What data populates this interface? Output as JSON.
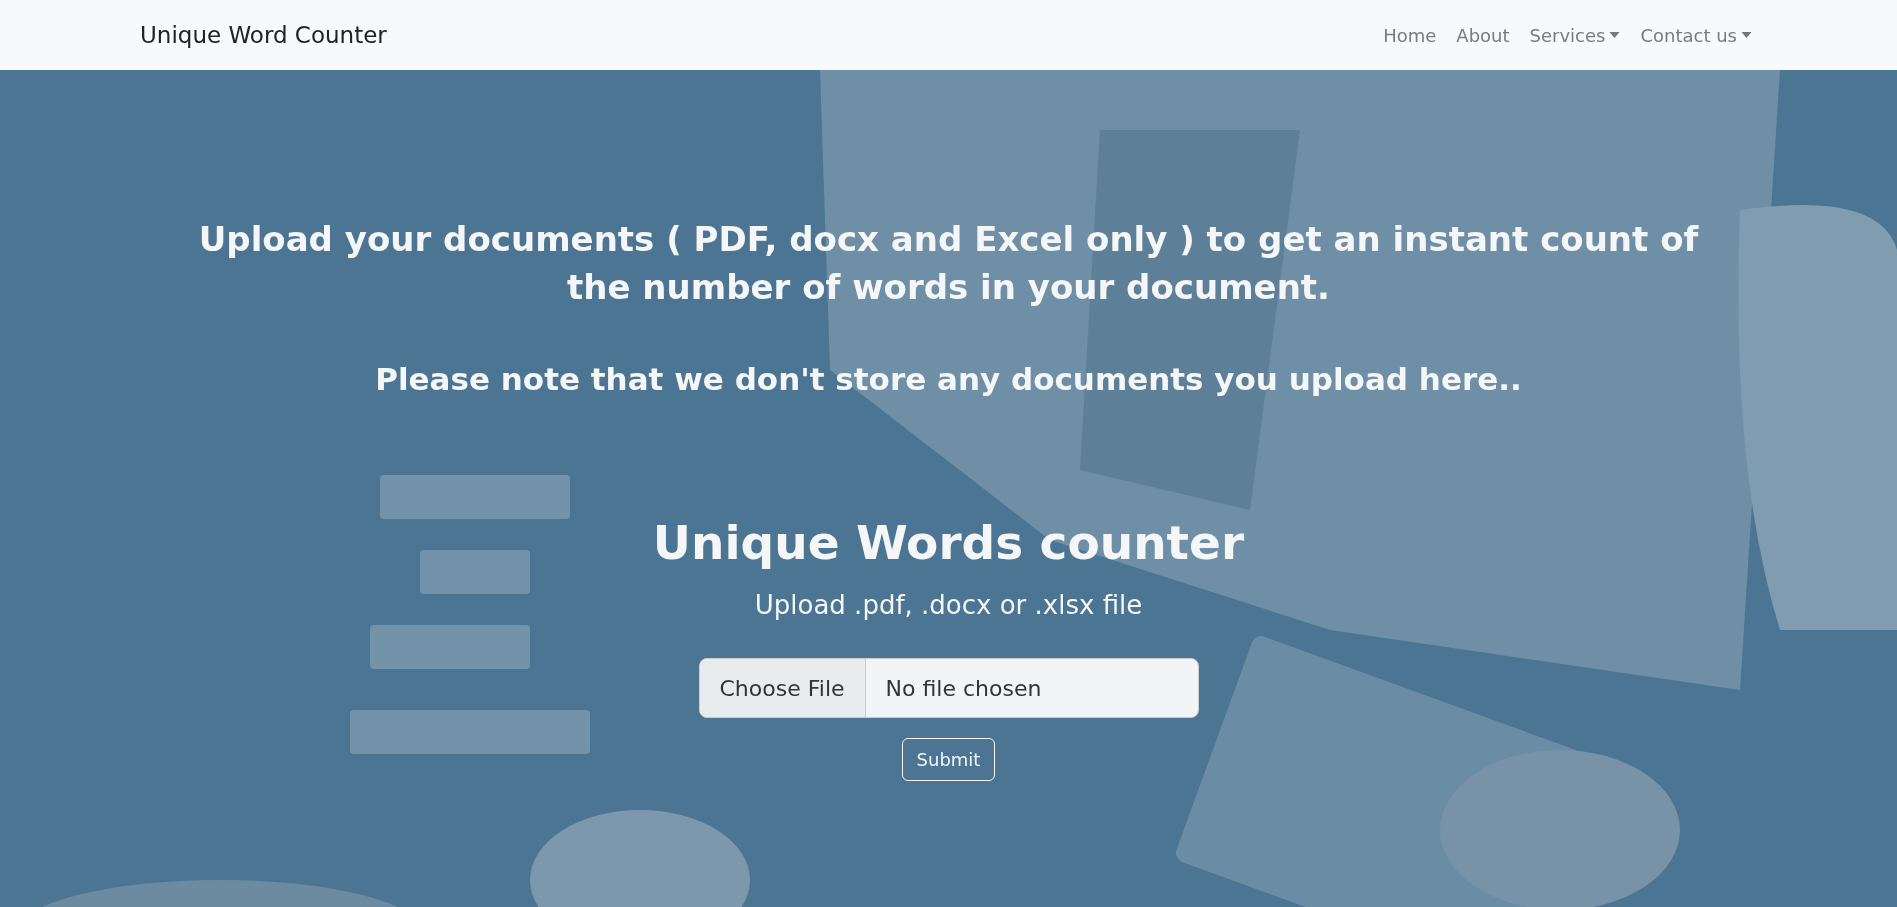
{
  "navbar": {
    "brand": "Unique Word Counter",
    "links": [
      {
        "label": "Home",
        "dropdown": false
      },
      {
        "label": "About",
        "dropdown": false
      },
      {
        "label": "Services",
        "dropdown": true
      },
      {
        "label": "Contact us",
        "dropdown": true
      }
    ]
  },
  "hero": {
    "intro": "Upload your documents ( PDF, docx and Excel only ) to get an instant count of the number of words in your document.",
    "note": "Please note that we don't store any documents you upload here..",
    "title": "Unique Words counter",
    "subtitle": "Upload .pdf, .docx or .xlsx file",
    "file_input": {
      "button": "Choose File",
      "status": "No file chosen"
    },
    "submit": "Submit"
  }
}
